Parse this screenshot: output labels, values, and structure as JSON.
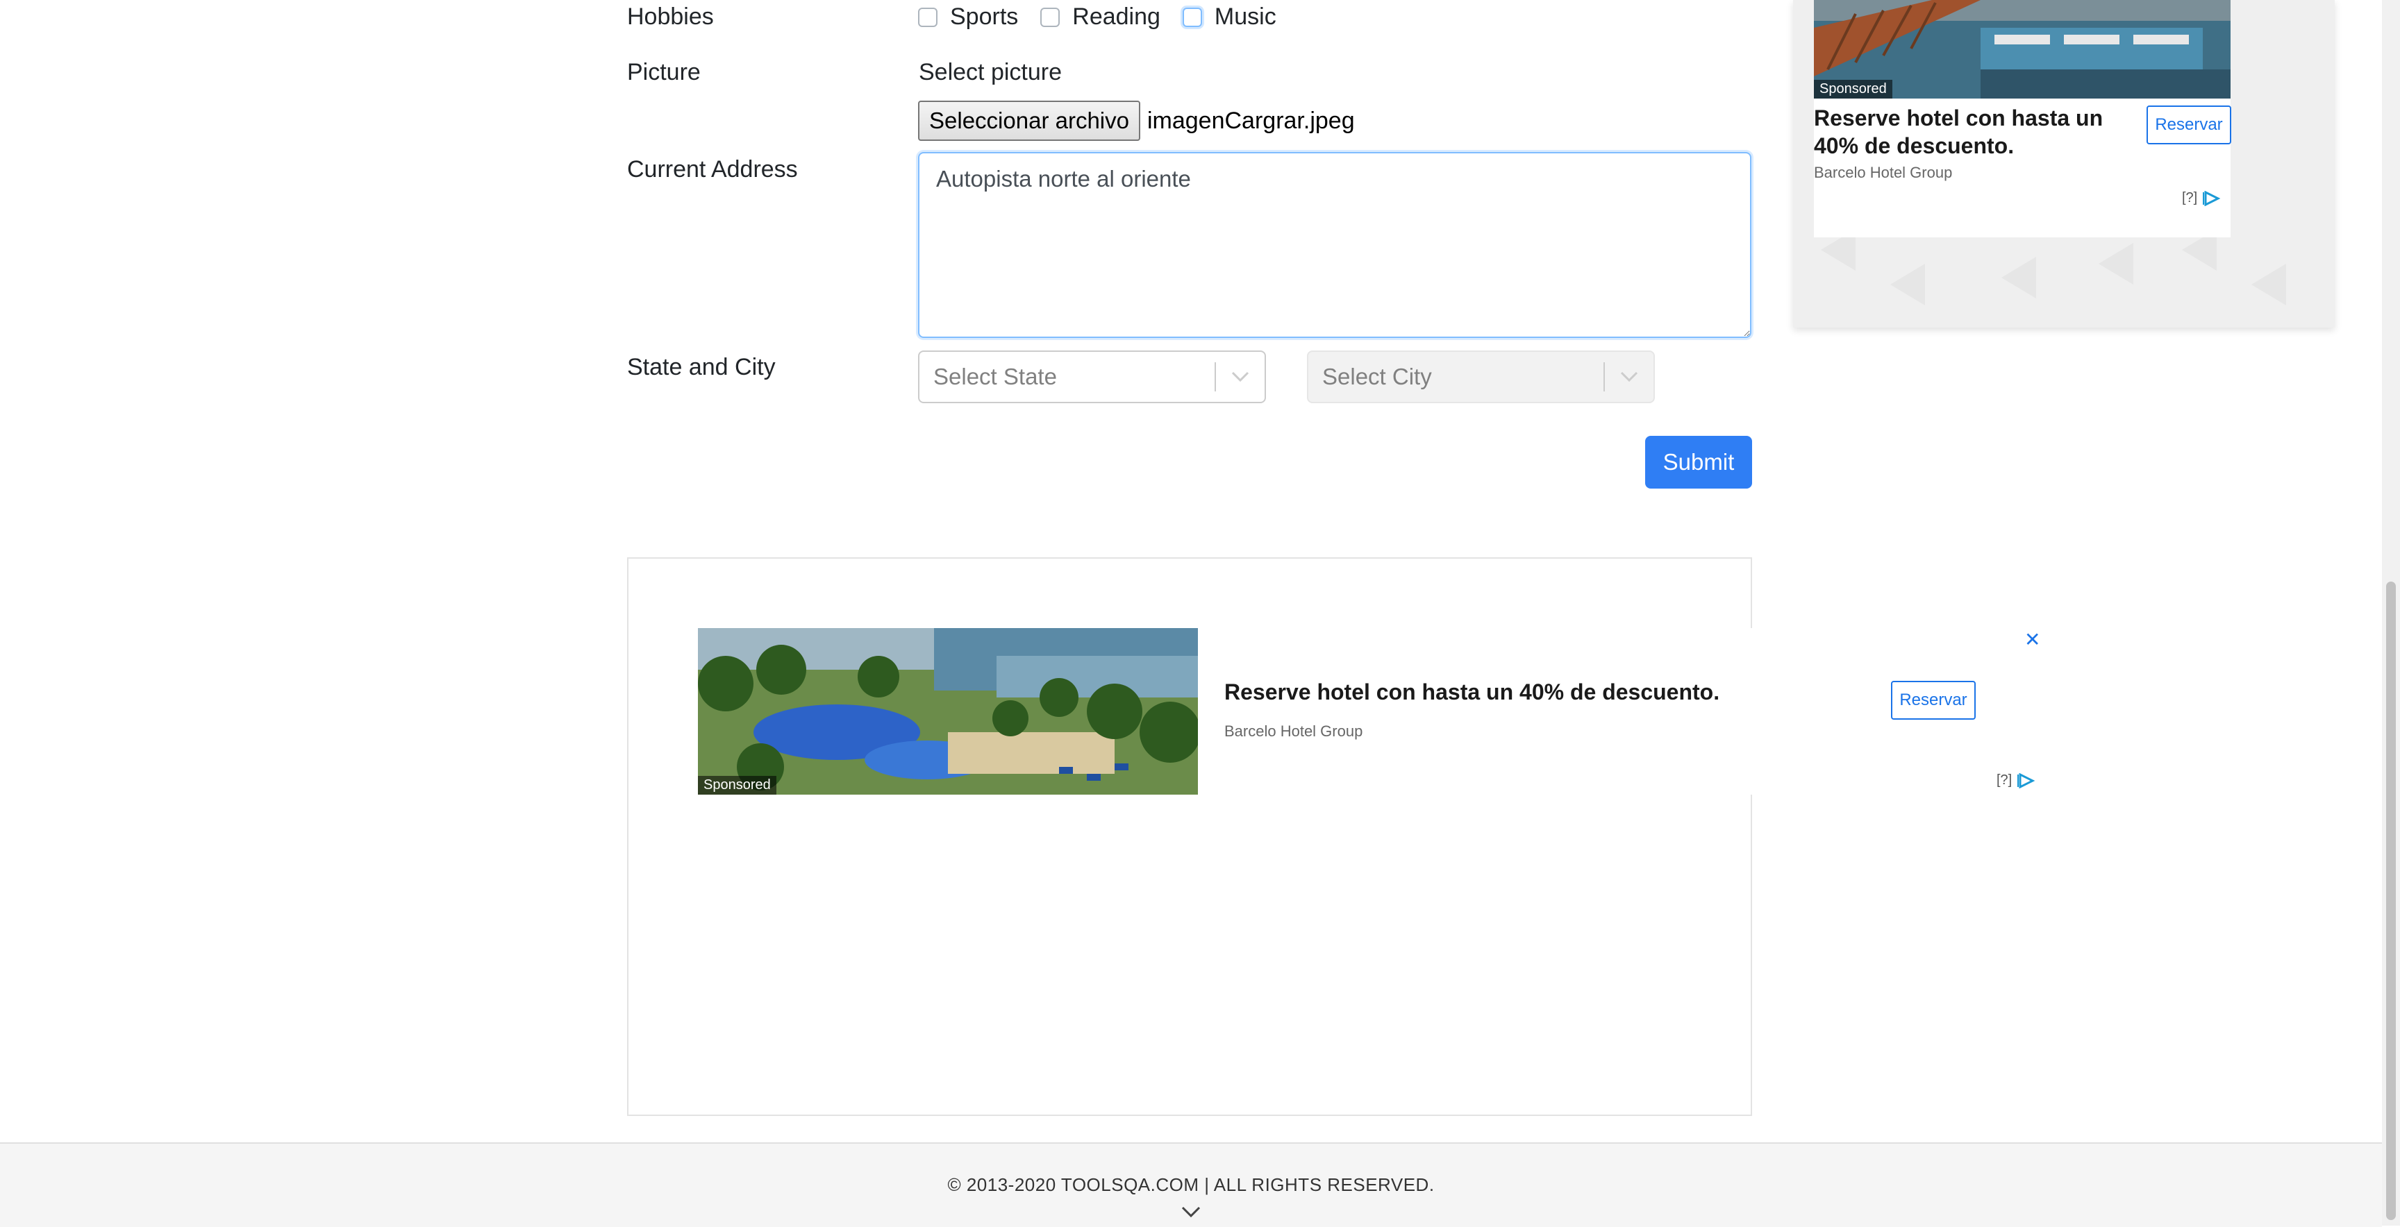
{
  "form": {
    "hobbies_label": "Hobbies",
    "hobbies": [
      {
        "label": "Sports",
        "checked": false
      },
      {
        "label": "Reading",
        "checked": false
      },
      {
        "label": "Music",
        "checked": false,
        "focused": true
      }
    ],
    "picture_label": "Picture",
    "select_picture_label": "Select picture",
    "file_button_label": "Seleccionar archivo",
    "file_name": "imagenCargrar.jpeg",
    "address_label": "Current Address",
    "address_value": "Autopista norte al oriente",
    "state_city_label": "State and City",
    "state_placeholder": "Select State",
    "city_placeholder": "Select City",
    "submit_label": "Submit"
  },
  "side_ad": {
    "sponsored": "Sponsored",
    "title": "Reserve hotel con hasta un 40% de descuento.",
    "advertiser": "Barcelo Hotel Group",
    "cta": "Reservar",
    "adchoices": "[?]"
  },
  "bottom_ad": {
    "sponsored": "Sponsored",
    "title": "Reserve hotel con hasta un 40% de descuento.",
    "advertiser": "Barcelo Hotel Group",
    "cta": "Reservar",
    "close": "✕",
    "adchoices": "[?]"
  },
  "footer": {
    "text": "© 2013-2020 TOOLSQA.COM | ALL RIGHTS RESERVED."
  },
  "colors": {
    "primary": "#2f7ef4",
    "focus_border": "#80bdff",
    "ad_blue": "#1a73e8"
  },
  "icons": {
    "select_indicator": "chevron-down-icon",
    "adchoices": "adchoices-icon",
    "footer_toggle": "chevron-down-icon"
  }
}
